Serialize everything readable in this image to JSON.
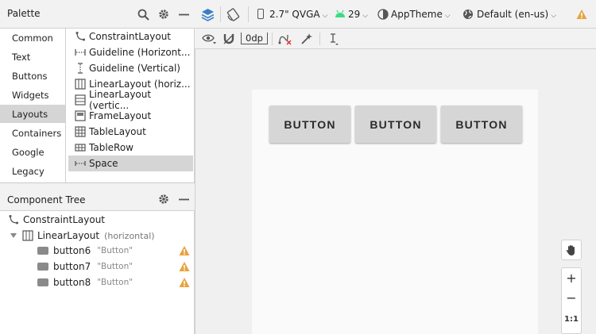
{
  "palette": {
    "title": "Palette",
    "categories": [
      "Common",
      "Text",
      "Buttons",
      "Widgets",
      "Layouts",
      "Containers",
      "Google",
      "Legacy"
    ],
    "selected_category": "Layouts",
    "items": [
      {
        "label": "ConstraintLayout",
        "icon": "constraint-layout-icon"
      },
      {
        "label": "Guideline (Horizont...",
        "icon": "guideline-horizontal-icon"
      },
      {
        "label": "Guideline (Vertical)",
        "icon": "guideline-vertical-icon"
      },
      {
        "label": "LinearLayout (horiz...",
        "icon": "linear-layout-horizontal-icon"
      },
      {
        "label": "LinearLayout (vertic...",
        "icon": "linear-layout-vertical-icon"
      },
      {
        "label": "FrameLayout",
        "icon": "frame-layout-icon"
      },
      {
        "label": "TableLayout",
        "icon": "table-layout-icon"
      },
      {
        "label": "TableRow",
        "icon": "table-row-icon"
      },
      {
        "label": "Space",
        "icon": "space-icon"
      }
    ],
    "selected_item": "Space"
  },
  "component_tree": {
    "title": "Component Tree",
    "root": "ConstraintLayout",
    "linear": {
      "name": "LinearLayout",
      "qualifier": "(horizontal)"
    },
    "buttons": [
      {
        "id": "button6",
        "text": "\"Button\""
      },
      {
        "id": "button7",
        "text": "\"Button\""
      },
      {
        "id": "button8",
        "text": "\"Button\""
      }
    ]
  },
  "toolbar": {
    "device": "2.7\" QVGA",
    "api": "29",
    "theme": "AppTheme",
    "locale": "Default (en-us)",
    "margin": "0dp"
  },
  "canvas": {
    "buttons": [
      "BUTTON",
      "BUTTON",
      "BUTTON"
    ]
  },
  "zoom": {
    "plus": "+",
    "minus": "−",
    "actual": "1:1"
  },
  "colors": {
    "warning": "#e8a33d",
    "android_green": "#3ddc84",
    "selected_bg": "#d5d5d5",
    "accent_blue": "#3b7ec4"
  }
}
